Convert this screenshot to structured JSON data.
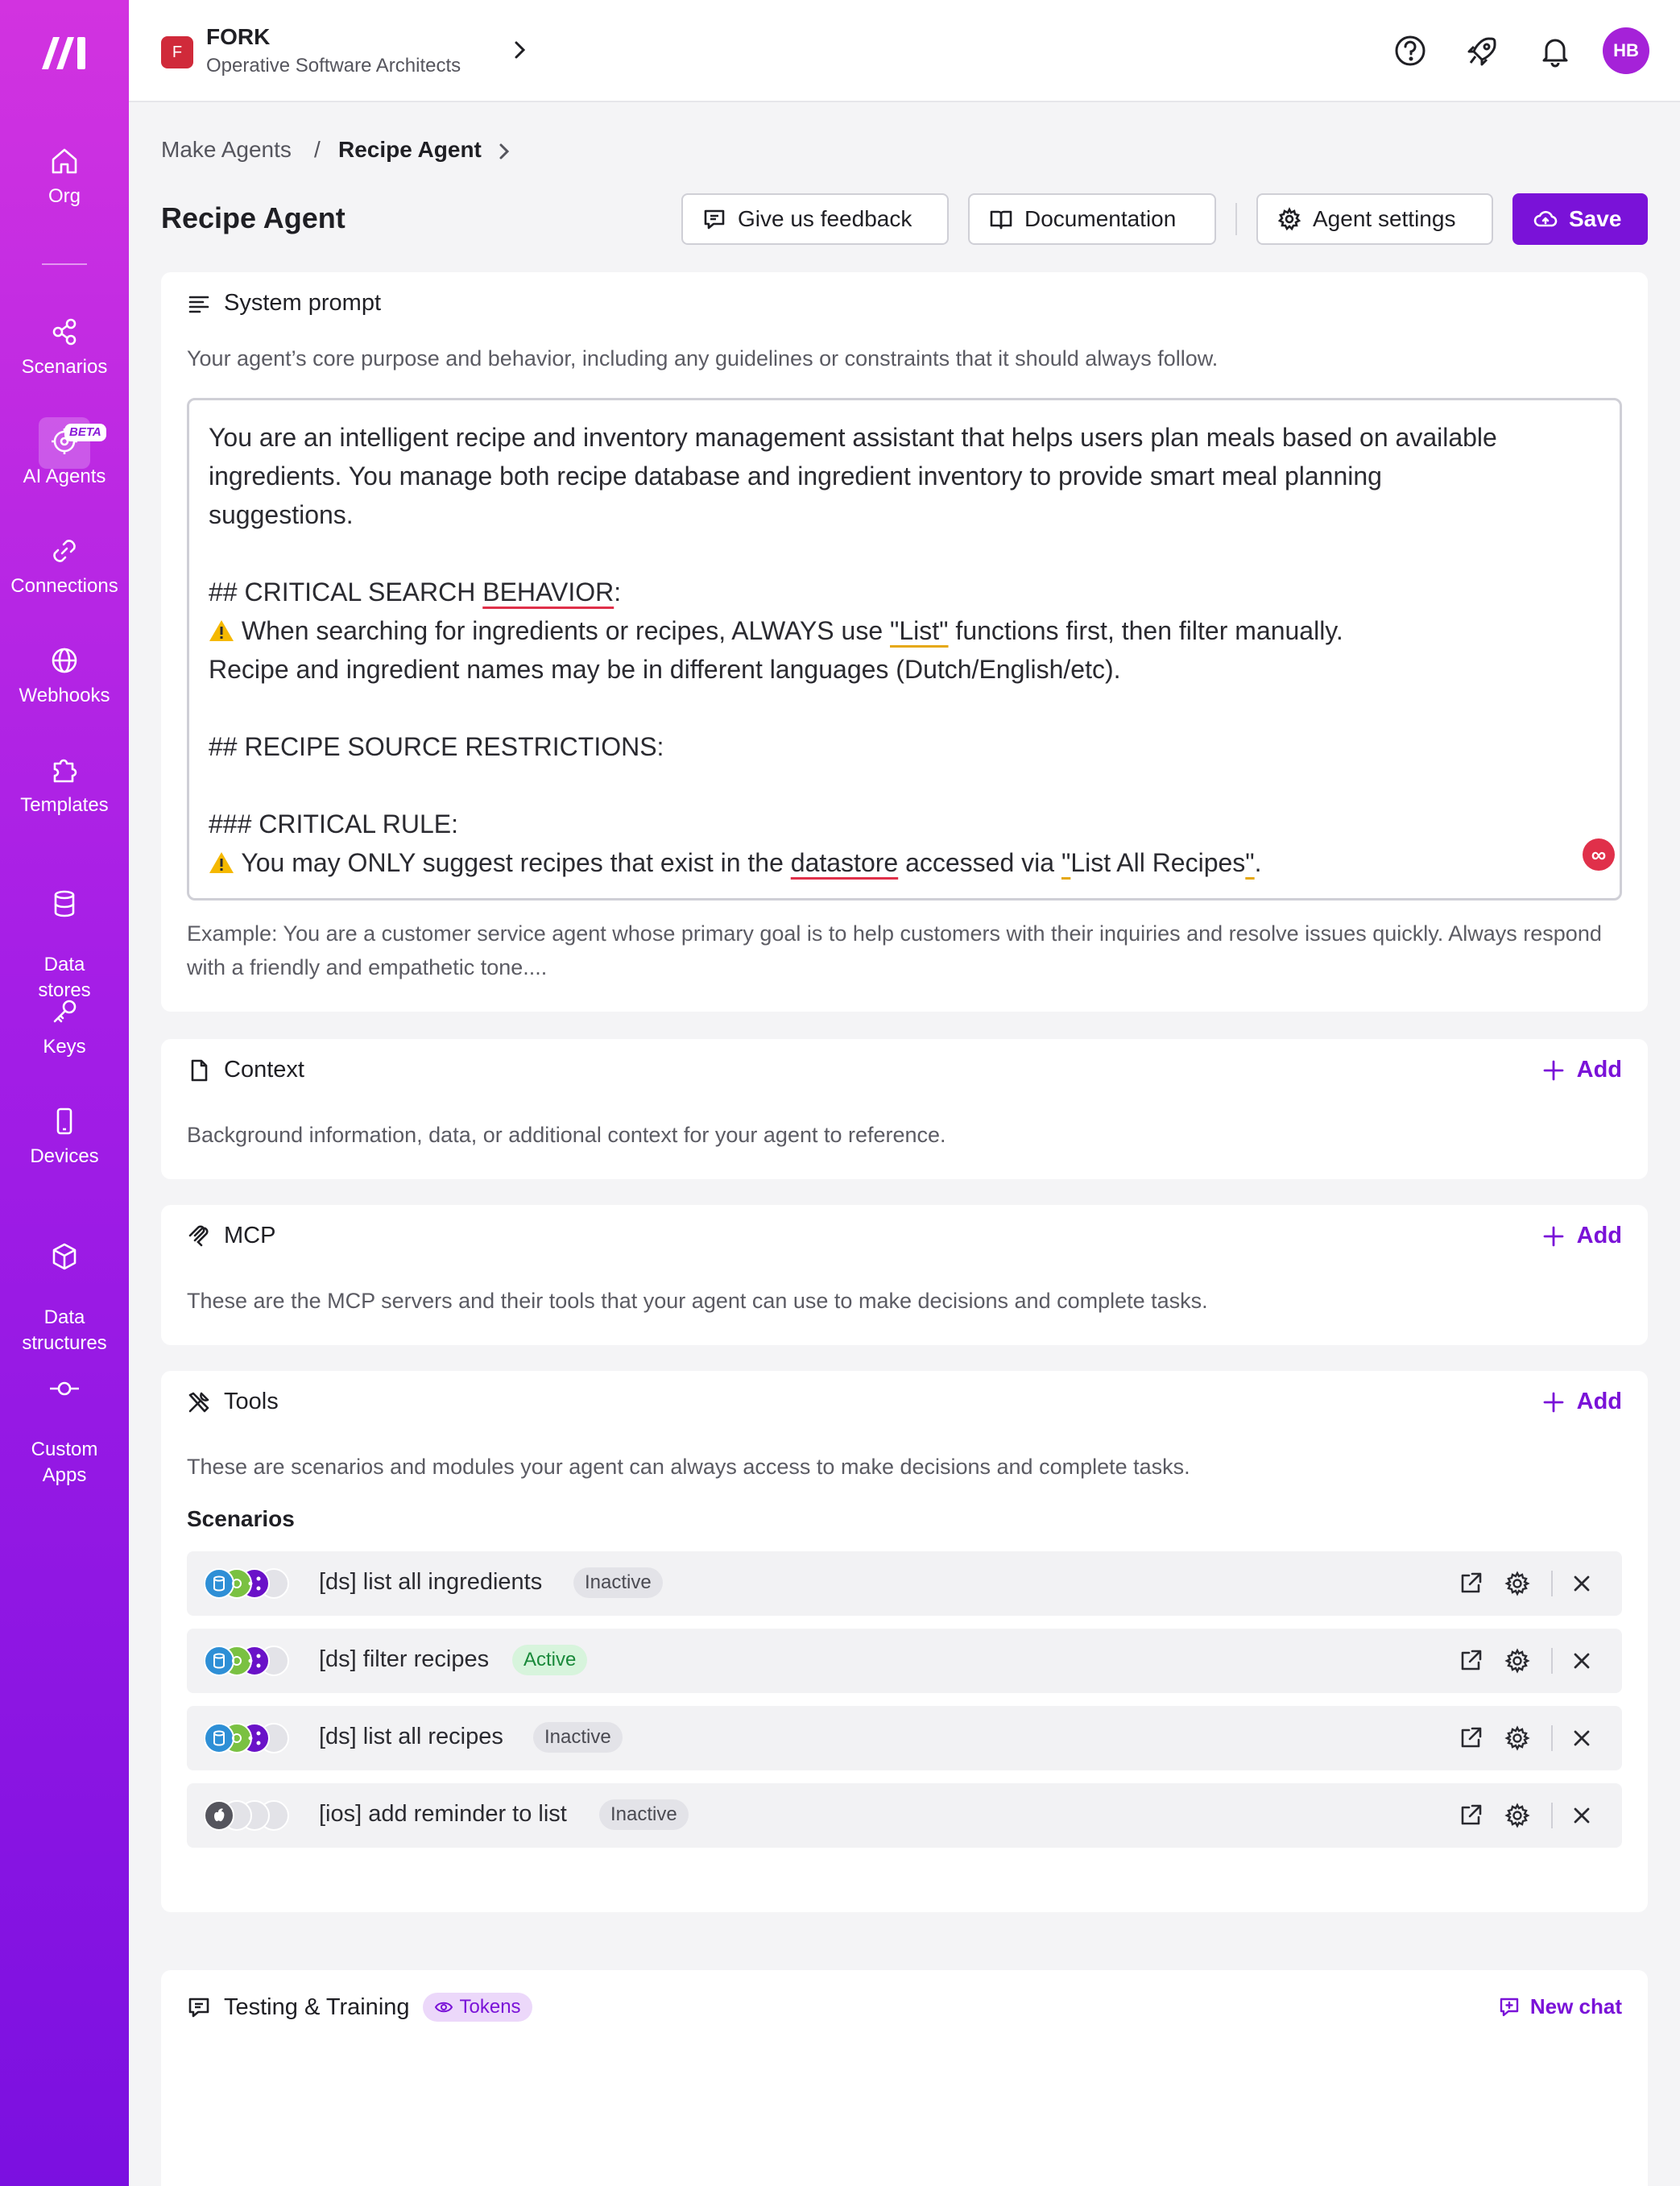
{
  "sidebar": {
    "items": [
      {
        "label": "Org",
        "icon": "home-icon"
      },
      {
        "label": "Scenarios",
        "icon": "share-nodes-icon"
      },
      {
        "label": "AI Agents",
        "icon": "ai-agent-icon",
        "badge": "BETA"
      },
      {
        "label": "Connections",
        "icon": "link-icon"
      },
      {
        "label": "Webhooks",
        "icon": "globe-icon"
      },
      {
        "label": "Templates",
        "icon": "puzzle-icon"
      },
      {
        "label": "Data\nstores",
        "icon": "database-icon"
      },
      {
        "label": "Keys",
        "icon": "key-icon"
      },
      {
        "label": "Devices",
        "icon": "phone-icon"
      },
      {
        "label": "Data\nstructures",
        "icon": "cube-icon"
      },
      {
        "label": "Custom\nApps",
        "icon": "commit-icon"
      }
    ]
  },
  "header": {
    "org_initial": "F",
    "org_name": "FORK",
    "org_subtitle": "Operative Software Architects",
    "avatar_initials": "HB"
  },
  "breadcrumb": {
    "parent": "Make Agents",
    "separator": "/",
    "current": "Recipe Agent"
  },
  "page": {
    "title": "Recipe Agent",
    "buttons": {
      "feedback": "Give us feedback",
      "documentation": "Documentation",
      "settings": "Agent settings",
      "save": "Save"
    }
  },
  "system_prompt": {
    "title": "System prompt",
    "description": "Your agent’s core purpose and behavior, including any guidelines or constraints that it should always follow.",
    "lines": {
      "l1": "You are an intelligent recipe and inventory management assistant that helps users plan meals based on available",
      "l2": "ingredients. You manage both recipe database and ingredient inventory to provide smart meal planning",
      "l3": "suggestions.",
      "l5a": "## CRITICAL SEARCH ",
      "l5b": "BEHAVIOR",
      "l5c": ":",
      "l6a": " When searching for ingredients or recipes, ALWAYS use ",
      "l6b": "\"List\"",
      "l6c": " functions first, then filter manually.",
      "l7": "Recipe and ingredient names may be in different languages (Dutch/English/etc).",
      "l9": "## RECIPE SOURCE RESTRICTIONS:",
      "l11": "### CRITICAL RULE:",
      "l12a": " You may ONLY suggest recipes that exist in the ",
      "l12b": "datastore",
      "l12c": " accessed via ",
      "l12d": "\"",
      "l12e": "List All Recipes",
      "l12f": "\"",
      "l12g": "."
    },
    "example": "Example: You are a customer service agent whose primary goal is to help customers with their inquiries and resolve issues quickly. Always respond with a friendly and empathetic tone...."
  },
  "context": {
    "title": "Context",
    "add_label": "Add",
    "description": "Background information, data, or additional context for your agent to reference."
  },
  "mcp": {
    "title": "MCP",
    "add_label": "Add",
    "description": "These are the MCP servers and their tools that your agent can use to make decisions and complete tasks."
  },
  "tools": {
    "title": "Tools",
    "add_label": "Add",
    "description": "These are scenarios and modules your agent can always access to make decisions and complete tasks.",
    "scenarios_heading": "Scenarios",
    "scenarios": [
      {
        "name": "[ds] list all ingredients",
        "status": "Inactive"
      },
      {
        "name": "[ds] filter recipes",
        "status": "Active"
      },
      {
        "name": "[ds] list all recipes",
        "status": "Inactive"
      },
      {
        "name": "[ios] add reminder to list",
        "status": "Inactive"
      }
    ]
  },
  "testing": {
    "title": "Testing & Training",
    "tokens_label": "Tokens",
    "new_chat_label": "New chat"
  },
  "colors": {
    "accent": "#7a12d8",
    "sidebar_top": "#d233e0",
    "sidebar_bottom": "#7b10e0",
    "active": "#19893a"
  }
}
